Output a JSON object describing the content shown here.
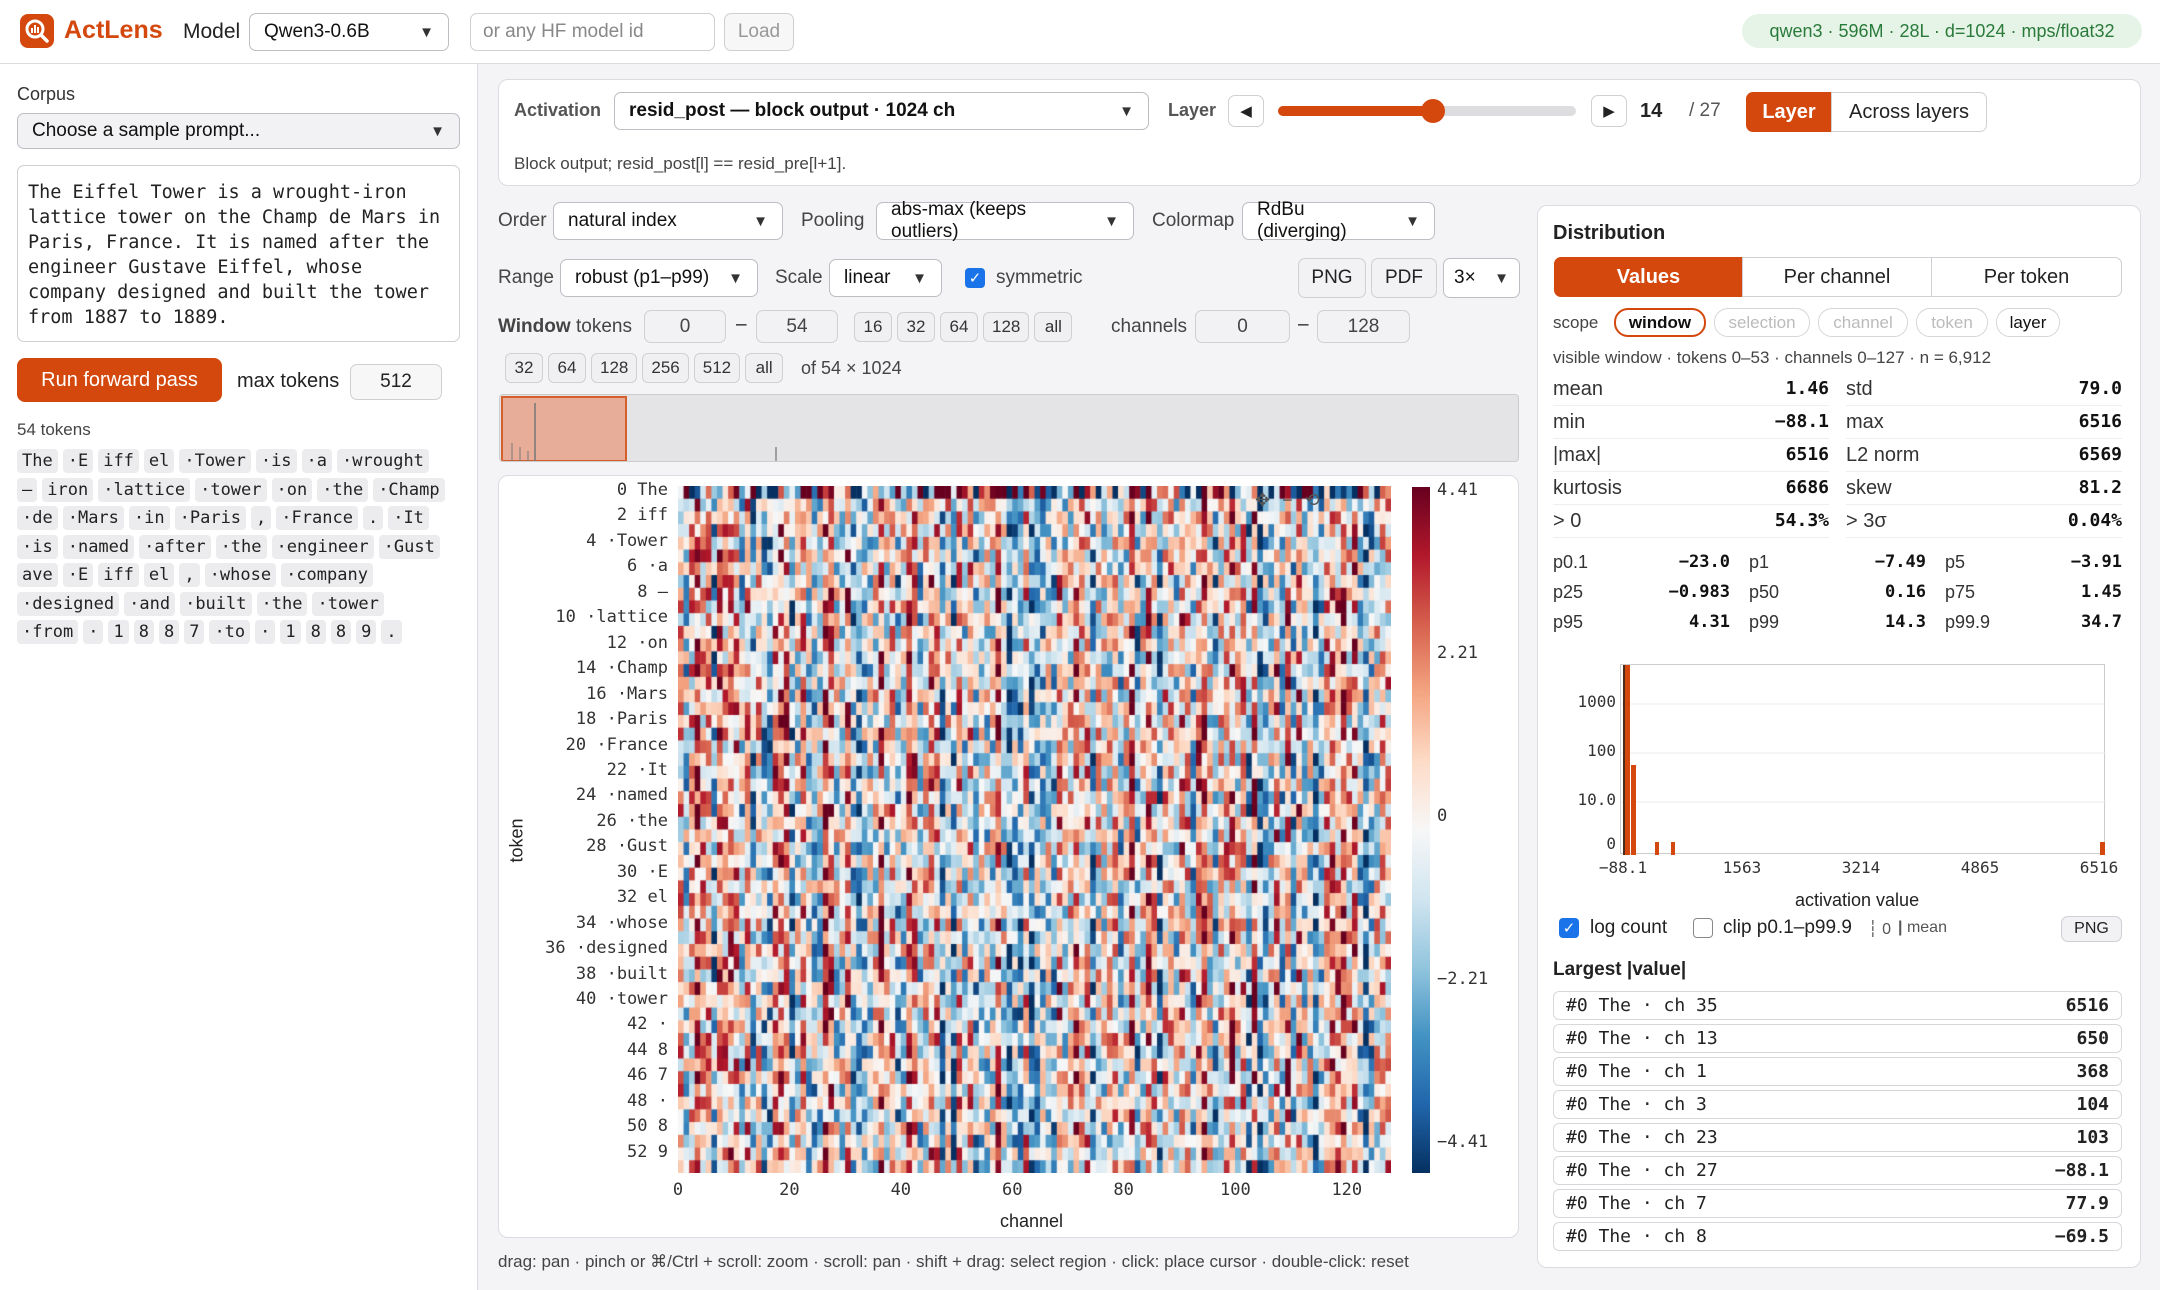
{
  "app": {
    "name": "ActLens",
    "model_label": "Model",
    "model_selected": "Qwen3-0.6B",
    "hf_placeholder": "or any HF model id",
    "load_label": "Load",
    "model_info": "qwen3 · 596M · 28L · d=1024 · mps/float32"
  },
  "sidebar": {
    "corpus_label": "Corpus",
    "sample_prompt": "Choose a sample prompt...",
    "prompt_text": "The Eiffel Tower is a wrought-iron lattice tower on the Champ de Mars in Paris, France. It is named after the engineer Gustave Eiffel, whose company designed and built the tower from 1887 to 1889.",
    "run_label": "Run forward pass",
    "max_tokens_label": "max tokens",
    "max_tokens_value": "512",
    "token_count": "54 tokens",
    "token_rows": [
      [
        "The",
        "·E",
        "iff",
        "el",
        "·Tower",
        "·is",
        "·a",
        "·wrought"
      ],
      [
        "–",
        "iron",
        "·lattice",
        "·tower",
        "·on",
        "·the",
        "·Champ"
      ],
      [
        "·de",
        "·Mars",
        "·in",
        "·Paris",
        ",",
        "·France",
        ".",
        "·It"
      ],
      [
        "·is",
        "·named",
        "·after",
        "·the",
        "·engineer",
        "·Gust"
      ],
      [
        "ave",
        "·E",
        "iff",
        "el",
        ",",
        "·whose",
        "·company"
      ],
      [
        "·designed",
        "·and",
        "·built",
        "·the",
        "·tower"
      ],
      [
        "·from",
        "·",
        "1",
        "8",
        "8",
        "7",
        "·to",
        "·",
        "1",
        "8",
        "8",
        "9",
        "."
      ]
    ]
  },
  "activation": {
    "label": "Activation",
    "selected": "resid_post — block output · 1024 ch",
    "layer_label": "Layer",
    "layer_value": "14",
    "layer_total": "/ 27",
    "layer_fraction": 0.52,
    "mode_layer": "Layer",
    "mode_across": "Across layers",
    "description": "Block output; resid_post[l] == resid_pre[l+1]."
  },
  "controls": {
    "order_label": "Order",
    "order_value": "natural index",
    "pooling_label": "Pooling",
    "pooling_value": "abs-max (keeps outliers)",
    "colormap_label": "Colormap",
    "colormap_value": "RdBu (diverging)",
    "range_label": "Range",
    "range_value": "robust (p1–p99)",
    "scale_label": "Scale",
    "scale_value": "linear",
    "symmetric_label": "symmetric",
    "png": "PNG",
    "pdf": "PDF",
    "zoom": "3×",
    "window_label": "Window",
    "tokens_label": "tokens",
    "tok_from": "0",
    "dash": "–",
    "tok_to": "54",
    "tok_presets": [
      "16",
      "32",
      "64",
      "128",
      "all"
    ],
    "channels_label": "channels",
    "ch_from": "0",
    "ch_to": "128",
    "ch_presets": [
      "32",
      "64",
      "128",
      "256",
      "512",
      "all"
    ],
    "of_label": "of 54 × 1024"
  },
  "heatmap": {
    "ylabel": "token",
    "xlabel": "channel",
    "xticks": [
      "0",
      "20",
      "40",
      "60",
      "80",
      "100",
      "120"
    ],
    "yticks": [
      "0 The",
      "2 iff",
      "4 ·Tower",
      "6 ·a",
      "8 –",
      "10 ·lattice",
      "12 ·on",
      "14 ·Champ",
      "16 ·Mars",
      "18 ·Paris",
      "20 ·France",
      "22 ·It",
      "24 ·named",
      "26 ·the",
      "28 ·Gust",
      "30 ·E",
      "32 el",
      "34 ·whose",
      "36 ·designed",
      "38 ·built",
      "40 ·tower",
      "42 ·",
      "44 8",
      "46 7",
      "48 ·",
      "50 8",
      "52 9"
    ],
    "colorbar": [
      "4.41",
      "2.21",
      "0",
      "−2.21",
      "−4.41"
    ],
    "hint": "drag: pan · pinch or ⌘/Ctrl + scroll: zoom · scroll: pan · shift + drag: select region · click: place cursor · double-click: reset"
  },
  "distribution": {
    "title": "Distribution",
    "tabs": [
      "Values",
      "Per channel",
      "Per token"
    ],
    "scope_label": "scope",
    "scopes": [
      "window",
      "selection",
      "channel",
      "token",
      "layer"
    ],
    "summary": "visible window · tokens 0–53 · channels 0–127 · n = 6,912",
    "stats": [
      [
        "mean",
        "1.46",
        "std",
        "79.0"
      ],
      [
        "min",
        "−88.1",
        "max",
        "6516"
      ],
      [
        "|max|",
        "6516",
        "L2 norm",
        "6569"
      ],
      [
        "kurtosis",
        "6686",
        "skew",
        "81.2"
      ],
      [
        "> 0",
        "54.3%",
        "> 3σ",
        "0.04%"
      ]
    ],
    "percentiles": [
      [
        "p0.1",
        "−23.0",
        "p1",
        "−7.49",
        "p5",
        "−3.91"
      ],
      [
        "p25",
        "−0.983",
        "p50",
        "0.16",
        "p75",
        "1.45"
      ],
      [
        "p95",
        "4.31",
        "p99",
        "14.3",
        "p99.9",
        "34.7"
      ]
    ],
    "hist_yticks": [
      "1000",
      "100",
      "10.0",
      "0"
    ],
    "hist_xticks": [
      "−88.1",
      "1563",
      "3214",
      "4865",
      "6516"
    ],
    "hist_xlabel": "activation value",
    "log_count": "log count",
    "clip": "clip p0.1–p99.9",
    "legend_zero": "0",
    "legend_mean": "mean",
    "png": "PNG",
    "largest_title": "Largest |value|",
    "largest": [
      [
        "#0 The · ch 35",
        "6516"
      ],
      [
        "#0 The · ch 13",
        "650"
      ],
      [
        "#0 The · ch 1",
        "368"
      ],
      [
        "#0 The · ch 3",
        "104"
      ],
      [
        "#0 The · ch 23",
        "103"
      ],
      [
        "#0 The · ch 27",
        "−88.1"
      ],
      [
        "#0 The · ch 7",
        "77.9"
      ],
      [
        "#0 The · ch 8",
        "−69.5"
      ]
    ]
  }
}
